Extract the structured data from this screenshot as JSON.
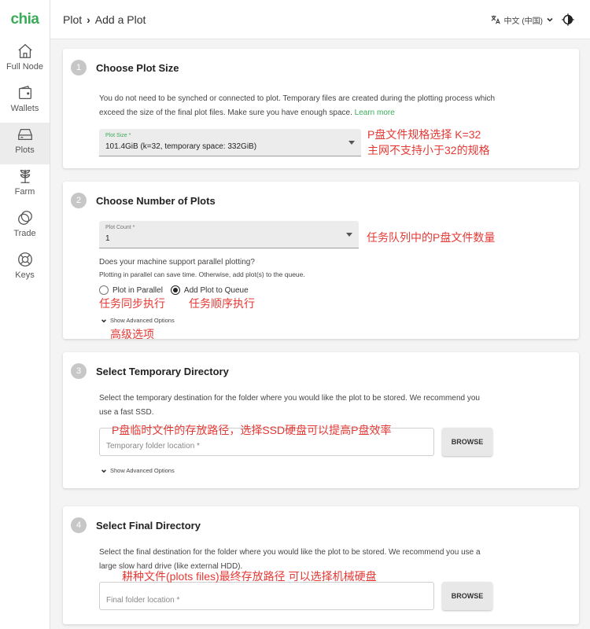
{
  "app": {
    "logo": "chia"
  },
  "sidebar": {
    "items": [
      {
        "label": "Full Node",
        "icon": "home-icon"
      },
      {
        "label": "Wallets",
        "icon": "wallet-icon"
      },
      {
        "label": "Plots",
        "icon": "hard-drive-icon",
        "active": true
      },
      {
        "label": "Farm",
        "icon": "sprout-icon"
      },
      {
        "label": "Trade",
        "icon": "circles-icon"
      },
      {
        "label": "Keys",
        "icon": "lifebuoy-icon"
      }
    ]
  },
  "header": {
    "breadcrumb": [
      "Plot",
      "Add a Plot"
    ],
    "language": "中文 (中国)"
  },
  "cards": {
    "plot_size": {
      "step": "1",
      "title": "Choose Plot Size",
      "description": "You do not need to be synched or connected to plot. Temporary files are created during the plotting process which exceed the size of the final plot files. Make sure you have enough space.",
      "learn_more": "Learn more",
      "select_label": "Plot Size *",
      "select_value": "101.4GiB (k=32, temporary space: 332GiB)"
    },
    "plot_count": {
      "step": "2",
      "title": "Choose Number of Plots",
      "select_label": "Plot Count *",
      "select_value": "1",
      "question": "Does your machine support parallel plotting?",
      "hint": "Plotting in parallel can save time. Otherwise, add plot(s) to the queue.",
      "option_parallel": "Plot in Parallel",
      "option_queue": "Add Plot to Queue",
      "advanced": "Show Advanced Options"
    },
    "temp_dir": {
      "step": "3",
      "title": "Select Temporary Directory",
      "description": "Select the temporary destination for the folder where you would like the plot to be stored. We recommend you use a fast SSD.",
      "placeholder": "Temporary folder location *",
      "browse": "BROWSE",
      "advanced": "Show Advanced Options"
    },
    "final_dir": {
      "step": "4",
      "title": "Select Final Directory",
      "description": "Select the final destination for the folder where you would like the plot to be stored. We recommend you use a large slow hard drive (like external HDD).",
      "placeholder": "Final folder location *",
      "browse": "BROWSE"
    }
  },
  "annotations": {
    "plot_size_1": "P盘文件规格选择 K=32",
    "plot_size_2": "主网不支持小于32的规格",
    "plot_count": "任务队列中的P盘文件数量",
    "parallel": "任务同步执行",
    "queue": "任务顺序执行",
    "advanced": "高级选项",
    "temp_dir": "P盘临时文件的存放路径，选择SSD硬盘可以提高P盘效率",
    "final_dir": "耕种文件(plots files)最终存放路径 可以选择机械硬盘"
  },
  "colors": {
    "brand": "#3aac59",
    "annotation": "#e53935"
  }
}
